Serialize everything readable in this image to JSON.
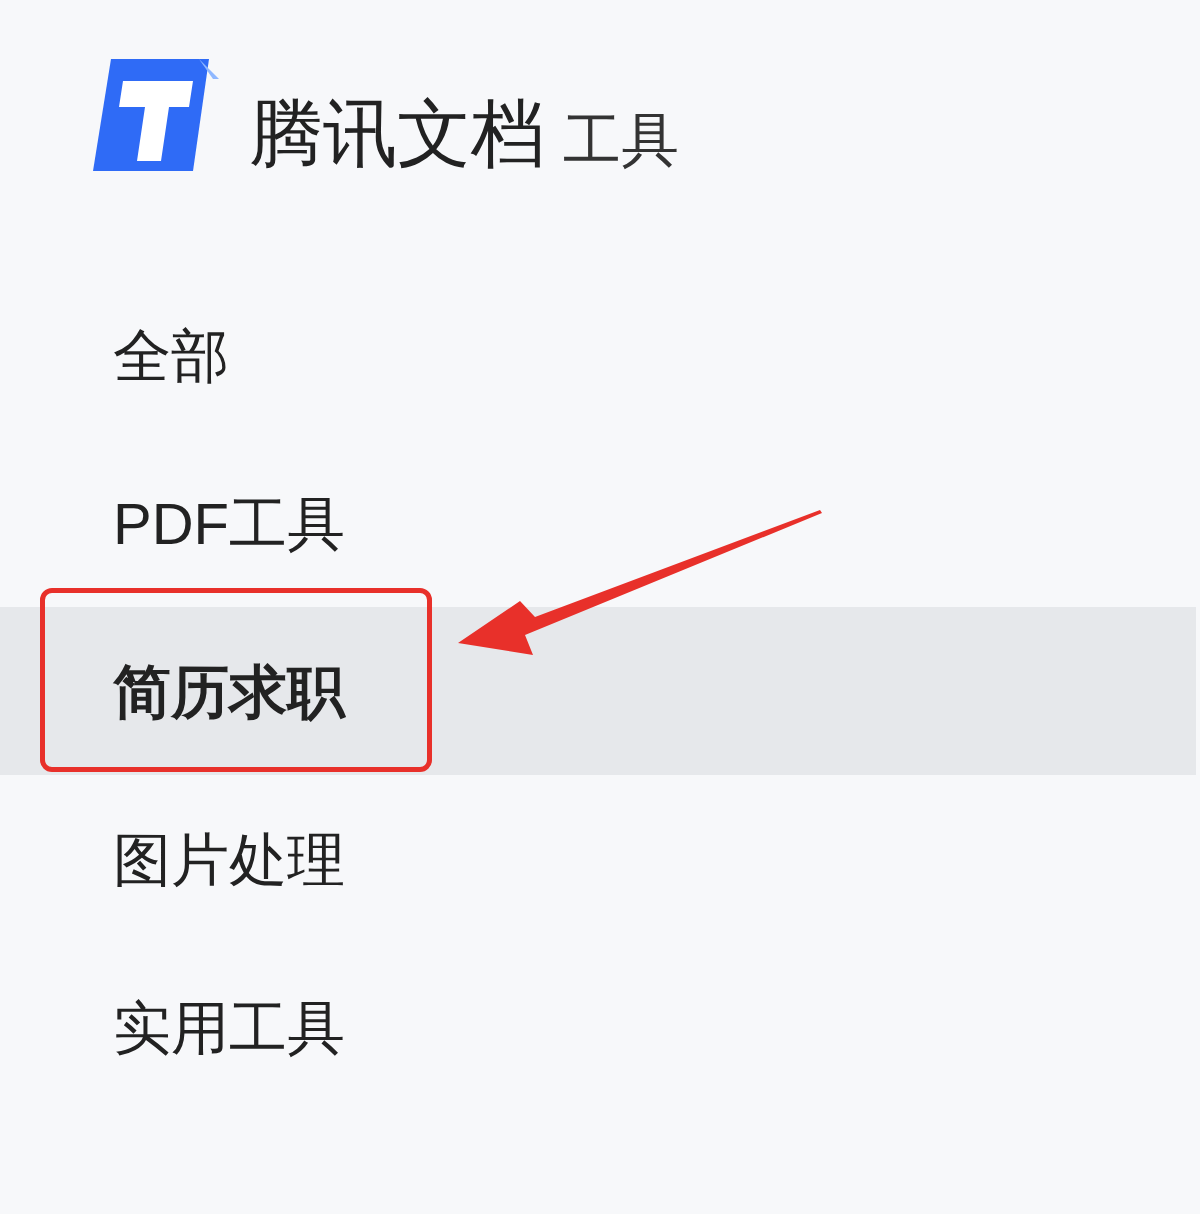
{
  "logo": {
    "name": "腾讯文档",
    "suffix": "工具"
  },
  "menu": [
    {
      "label": "全部",
      "selected": false
    },
    {
      "label": "PDF工具",
      "selected": false
    },
    {
      "label": "简历求职",
      "selected": true
    },
    {
      "label": "图片处理",
      "selected": false
    },
    {
      "label": "实用工具",
      "selected": false
    }
  ]
}
